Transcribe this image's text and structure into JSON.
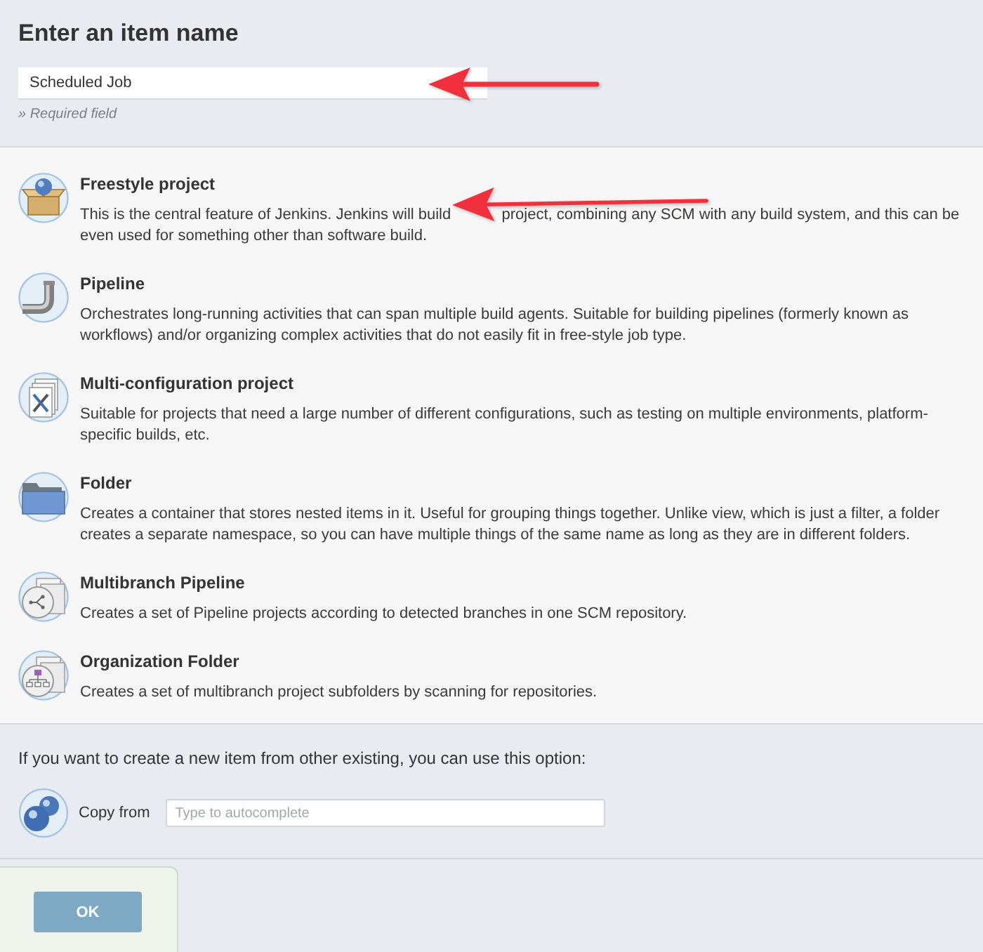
{
  "header": {
    "title": "Enter an item name"
  },
  "name_field": {
    "value": "Scheduled Job",
    "hint": "» Required field",
    "arrow": true
  },
  "item_types": [
    {
      "kind": "freestyle",
      "title": "Freestyle project",
      "description": [
        "This is the central feature of Jenkins. Jenkins will build",
        "project, combining any SCM with any build system, and this can be even used for something other than software build."
      ],
      "arrow": true
    },
    {
      "kind": "pipeline",
      "title": "Pipeline",
      "description": [
        "Orchestrates long-running activities that can span multiple build agents. Suitable for building pipelines (formerly known as workflows) and/or organizing complex activities that do not easily fit in free-style job type."
      ],
      "arrow": false
    },
    {
      "kind": "matrix",
      "title": "Multi-configuration project",
      "description": [
        "Suitable for projects that need a large number of different configurations, such as testing on multiple environments, platform-specific builds, etc."
      ],
      "arrow": false
    },
    {
      "kind": "folder",
      "title": "Folder",
      "description": [
        "Creates a container that stores nested items in it. Useful for grouping things together. Unlike view, which is just a filter, a folder creates a separate namespace, so you can have multiple things of the same name as long as they are in different folders."
      ],
      "arrow": false
    },
    {
      "kind": "multibranch",
      "title": "Multibranch Pipeline",
      "description": [
        "Creates a set of Pipeline projects according to detected branches in one SCM repository."
      ],
      "arrow": false
    },
    {
      "kind": "organization",
      "title": "Organization Folder",
      "description": [
        "Creates a set of multibranch project subfolders by scanning for repositories."
      ],
      "arrow": false
    }
  ],
  "copy_from": {
    "prompt": "If you want to create a new item from other existing, you can use this option:",
    "label": "Copy from",
    "placeholder": "Type to autocomplete"
  },
  "buttons": [
    {
      "label": "OK"
    }
  ]
}
